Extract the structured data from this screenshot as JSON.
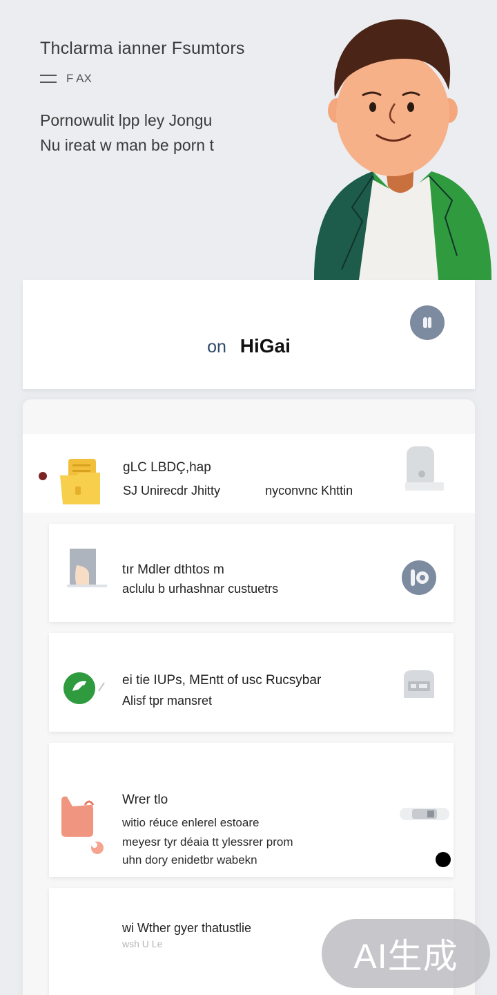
{
  "hero": {
    "title": "Thclarma ianner Fsumtors",
    "subtitle": "F AX",
    "desc_line1": "Pornowulit lpp ley Jongu",
    "desc_line2": "Nu ireat w man be porn t"
  },
  "header": {
    "prefix": "on",
    "title": "HiGai",
    "avatar_icon": "profile-icon"
  },
  "featured_item": {
    "line1": "gLC LBDÇ,hap",
    "line2": "SJ Unirecdr Jhitty",
    "line2_extra": "nyconvnc Khttin",
    "icon": "folder-icon",
    "right_icon": "document-icon"
  },
  "cards": [
    {
      "line1": "tır Mdler dthtos m",
      "line2": "aclulu b urhashnar custuetrs",
      "icon": "book-icon",
      "right_icon": "info-badge-icon"
    },
    {
      "line1": "ei tie IUPs, MEntt of usc Rucsybar",
      "line2": "Alisf tpr mansret",
      "icon": "leaf-badge-icon",
      "right_icon": "message-icon"
    },
    {
      "line1": "Wrer tlo",
      "line2": "witio réuce enlerel estoare",
      "line3": "meyesr tyr déaia tt ylessrer prom",
      "line4": "uhn dory enidetbr wabekn",
      "icon": "bag-icon",
      "right_icon": "toggle-icon"
    },
    {
      "line1": "wi Wther gyer thatustlie",
      "line2": "wsh U Le"
    }
  ],
  "watermark": "AI生成",
  "colors": {
    "background": "#ebedf1",
    "accent_blue": "#2e4a6b",
    "avatar_gray": "#7d8ba0",
    "green": "#2f9b3e"
  }
}
